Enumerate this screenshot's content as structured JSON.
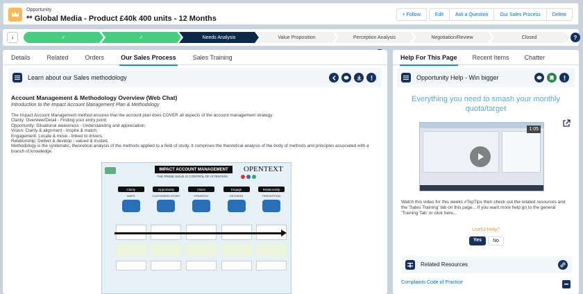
{
  "header": {
    "object_type": "Opportunity",
    "record_title": "** Global Media - Product £40k 400 units - 12 Months",
    "buttons": [
      "+ Follow",
      "Edit",
      "Ask a Question",
      "Our Sales Process",
      "Delete"
    ]
  },
  "path": {
    "stages": [
      {
        "label": "✓",
        "state": "done"
      },
      {
        "label": "✓",
        "state": "done"
      },
      {
        "label": "Needs Analysis",
        "state": "current"
      },
      {
        "label": "Value Proposition",
        "state": "todo"
      },
      {
        "label": "Perception Analysis",
        "state": "todo"
      },
      {
        "label": "Negotiation/Review",
        "state": "todo"
      },
      {
        "label": "Closed",
        "state": "todo"
      }
    ]
  },
  "left_tabs": [
    "Details",
    "Related",
    "Orders",
    "Our Sales Process",
    "Sales Training"
  ],
  "left_active_tab": "Our Sales Process",
  "methodology_card": {
    "label": "Learn about our Sales methodology"
  },
  "document": {
    "title": "Account Management & Methodology Overview (Web Chat)",
    "subtitle": "Introduction to the Impact Account Management Plan & Methodology",
    "paragraphs": [
      "The Impact Account Management method ensures that the account plan does COVER all aspects of the account management strategy:",
      "Clarity: Overview/Detail - Finding your entry point;",
      "Opportunity: Situational awareness - Understanding and appreciation;",
      "Vision: Clarity & alignment - Inspire & match;",
      "Engagement: Locate & move - linked to drivers.",
      "Relationship: Deliver & develop - valued & trusted.",
      "Methodology is the systematic, theoretical analysis of the methods applied to a field of study. It comprises the theoretical analysis of the body of methods and principles associated with a branch of knowledge."
    ]
  },
  "diagram": {
    "banner": "IMPACT ACCOUNT MANAGEMENT",
    "tagline": "THE PRIME ISSUE IS CONTROL OF ATTENTION",
    "brand": "OPENTEXT",
    "columns": [
      "Clarity",
      "Opportunity",
      "Vision",
      "Engage",
      "Relationship"
    ],
    "stages": [
      "MAPS",
      "CUSTOMERS STORY",
      "STRATEGY",
      "DECISION",
      "PERCEPTION"
    ]
  },
  "right_tabs": [
    "Help For This Page",
    "Recent Items",
    "Chatter"
  ],
  "right_active_tab": "Help For This Page",
  "help_card": {
    "label": "Opportunity Help - Win bigger",
    "headline": "Everything you need to smash your monthly quota/target",
    "video_duration": "1:05",
    "watch_text": "Watch this video for this weeks #TopTips then check out the related resources and the 'Sales Training' tab on this page... If you want more help go to the general 'Training Tab' or click here...",
    "useful_label": "Useful Help?",
    "yes_label": "Yes",
    "no_label": "No"
  },
  "related_resources": {
    "label": "Related Resources",
    "first_item": "Complaints Code of Practice"
  },
  "colors": {
    "done": "#4bca81",
    "current": "#0b2a4a",
    "brand_navy": "#16325c"
  }
}
